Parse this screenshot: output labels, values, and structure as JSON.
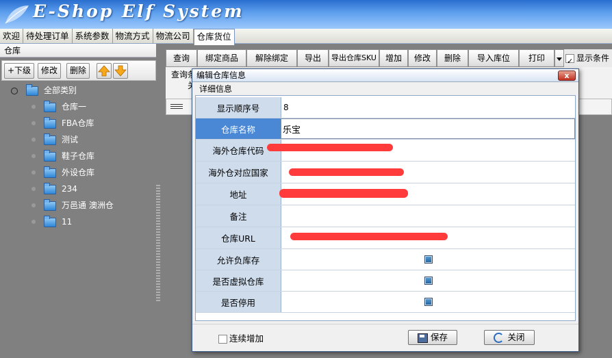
{
  "app": {
    "title": "E-Shop Elf System"
  },
  "tabs": [
    "欢迎",
    "待处理订单",
    "系统参数",
    "物流方式",
    "物流公司",
    "仓库货位"
  ],
  "active_tab": "仓库货位",
  "left_panel": {
    "title": "仓库",
    "buttons": {
      "add_child": "+下级",
      "edit": "修改",
      "delete": "删除"
    },
    "tree": {
      "root": "全部类别",
      "children": [
        "仓库一",
        "FBA仓库",
        "测试",
        "鞋子仓库",
        "外设仓库",
        "234",
        "万邑通 澳洲仓",
        "11"
      ]
    }
  },
  "toolbar": {
    "buttons": [
      "查询",
      "绑定商品",
      "解除绑定",
      "导出",
      "导出仓库SKU",
      "增加",
      "修改",
      "删除",
      "导入库位",
      "打印"
    ],
    "show_conditions_label": "显示条件"
  },
  "query_area": {
    "label": "查询条",
    "sub": "关"
  },
  "dialog": {
    "title": "编辑仓库信息",
    "close_label": "x",
    "section_tab": "详细信息",
    "fields": {
      "display_order": {
        "label": "显示顺序号",
        "value": "8"
      },
      "warehouse_name": {
        "label": "仓库名称",
        "value": "乐宝"
      },
      "overseas_code": {
        "label": "海外仓库代码"
      },
      "overseas_country": {
        "label": "海外仓对应国家"
      },
      "address": {
        "label": "地址"
      },
      "remark": {
        "label": "备注"
      },
      "warehouse_url": {
        "label": "仓库URL"
      },
      "allow_negative": {
        "label": "允许负库存",
        "checked": true
      },
      "is_virtual": {
        "label": "是否虚拟仓库",
        "checked": true
      },
      "is_disabled": {
        "label": "是否停用",
        "checked": true
      }
    },
    "continuous_add_label": "连续增加",
    "save_label": "保存",
    "close_button_label": "关闭"
  },
  "colors": {
    "selected_label": "#4a88d6",
    "label_bg": "#cfdcec",
    "redaction": "#ff3b3b"
  }
}
